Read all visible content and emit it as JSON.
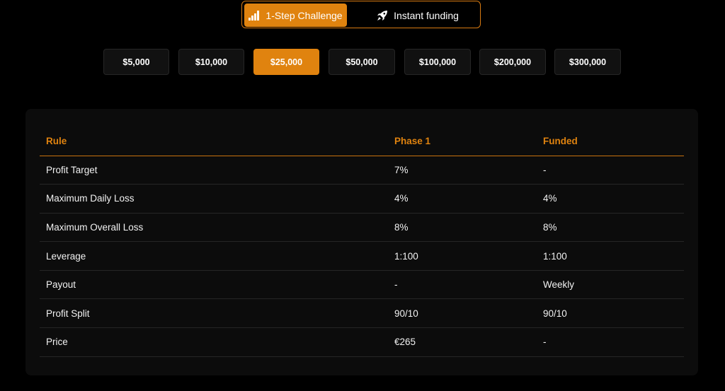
{
  "challenge_types": [
    {
      "label": "1-Step Challenge",
      "icon": "bar-steps-icon",
      "active": true
    },
    {
      "label": "Instant funding",
      "icon": "rocket-icon",
      "active": false
    }
  ],
  "amounts": [
    "$5,000",
    "$10,000",
    "$25,000",
    "$50,000",
    "$100,000",
    "$200,000",
    "$300,000"
  ],
  "selected_amount": "$25,000",
  "table": {
    "headers": [
      "Rule",
      "Phase 1",
      "Funded"
    ],
    "rows": [
      [
        "Profit Target",
        "7%",
        "-"
      ],
      [
        "Maximum Daily Loss",
        "4%",
        "4%"
      ],
      [
        "Maximum Overall Loss",
        "8%",
        "8%"
      ],
      [
        "Leverage",
        "1:100",
        "1:100"
      ],
      [
        "Payout",
        "-",
        "Weekly"
      ],
      [
        "Profit Split",
        "90/10",
        "90/10"
      ],
      [
        "Price",
        "€265",
        "-"
      ]
    ]
  },
  "colors": {
    "accent": "#e0830f",
    "background": "#000000",
    "card": "#0c0c0c"
  }
}
